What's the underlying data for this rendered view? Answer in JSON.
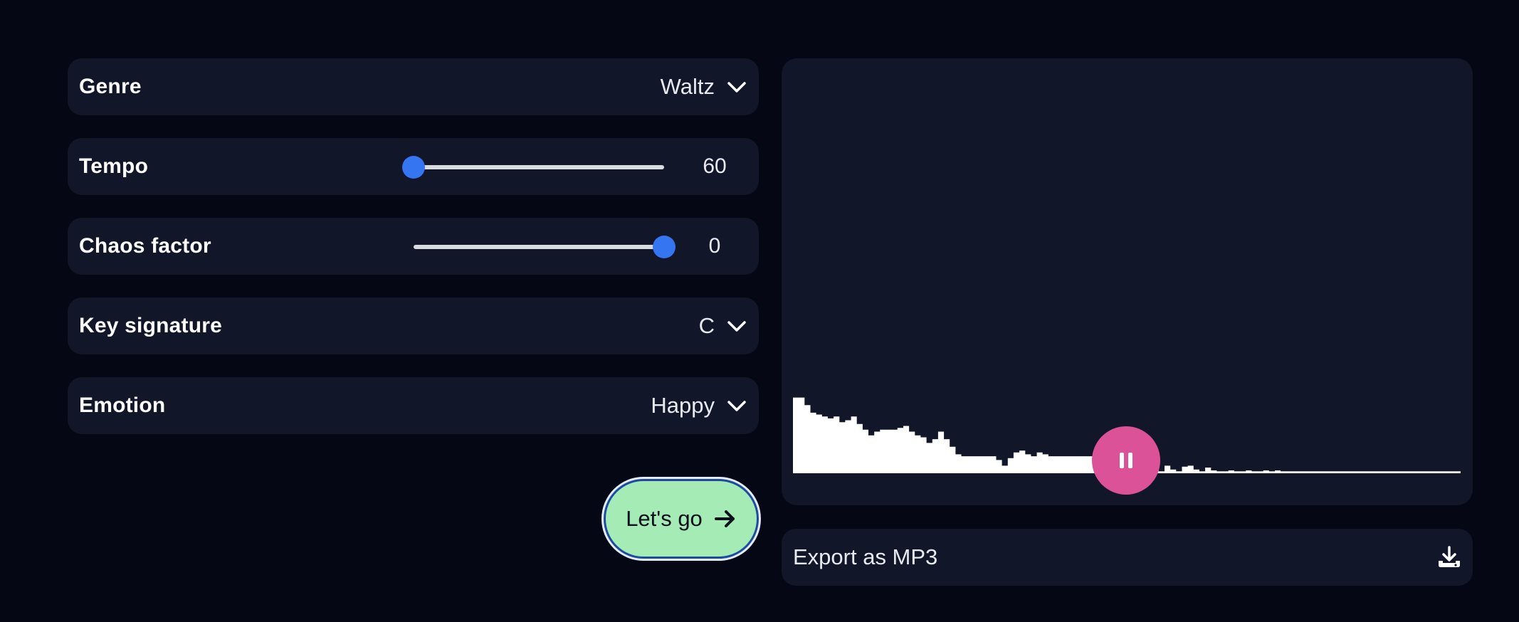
{
  "controls": {
    "genre": {
      "label": "Genre",
      "value": "Waltz"
    },
    "tempo": {
      "label": "Tempo",
      "value": "60",
      "slider_fraction": 0.0
    },
    "chaos": {
      "label": "Chaos factor",
      "value": "0",
      "slider_fraction": 1.0
    },
    "key": {
      "label": "Key signature",
      "value": "C"
    },
    "emotion": {
      "label": "Emotion",
      "value": "Happy"
    }
  },
  "actions": {
    "go_label": "Let's go"
  },
  "player": {
    "state": "playing",
    "waveform_levels": [
      0.8,
      0.8,
      0.72,
      0.64,
      0.62,
      0.6,
      0.58,
      0.6,
      0.54,
      0.56,
      0.6,
      0.52,
      0.46,
      0.4,
      0.44,
      0.46,
      0.46,
      0.46,
      0.48,
      0.5,
      0.44,
      0.4,
      0.38,
      0.32,
      0.36,
      0.44,
      0.36,
      0.28,
      0.2,
      0.18,
      0.18,
      0.18,
      0.18,
      0.18,
      0.18,
      0.14,
      0.08,
      0.16,
      0.22,
      0.24,
      0.2,
      0.18,
      0.22,
      0.2,
      0.18,
      0.18,
      0.18,
      0.18,
      0.18,
      0.18,
      0.18,
      0.18,
      0.18,
      0.18,
      0.16,
      0.1,
      0.06,
      0.04,
      0.08,
      0.04,
      0.02,
      0.08,
      0.06,
      0.02,
      0.08,
      0.04,
      0.02,
      0.07,
      0.08,
      0.04,
      0.02,
      0.06,
      0.03,
      0.02,
      0.02,
      0.03,
      0.02,
      0.02,
      0.03,
      0.02,
      0.02,
      0.03,
      0.02,
      0.03,
      0.02,
      0.02,
      0.02,
      0.02,
      0.02,
      0.02,
      0.02,
      0.02,
      0.02,
      0.02,
      0.02,
      0.02,
      0.02,
      0.02,
      0.02,
      0.02,
      0.02,
      0.02,
      0.02,
      0.02,
      0.02,
      0.02,
      0.02,
      0.02,
      0.02,
      0.02,
      0.02,
      0.02,
      0.02,
      0.02,
      0.02
    ]
  },
  "export": {
    "label": "Export as MP3"
  },
  "icons": {
    "dropdown": "chevron-down-icon",
    "go": "arrow-right-icon",
    "pause": "pause-icon",
    "download": "download-icon"
  },
  "colors": {
    "background": "#050814",
    "panel": "#111628",
    "slider_accent": "#3575f2",
    "go_button": "#a4ebb6",
    "pause_button": "#dc5298"
  }
}
